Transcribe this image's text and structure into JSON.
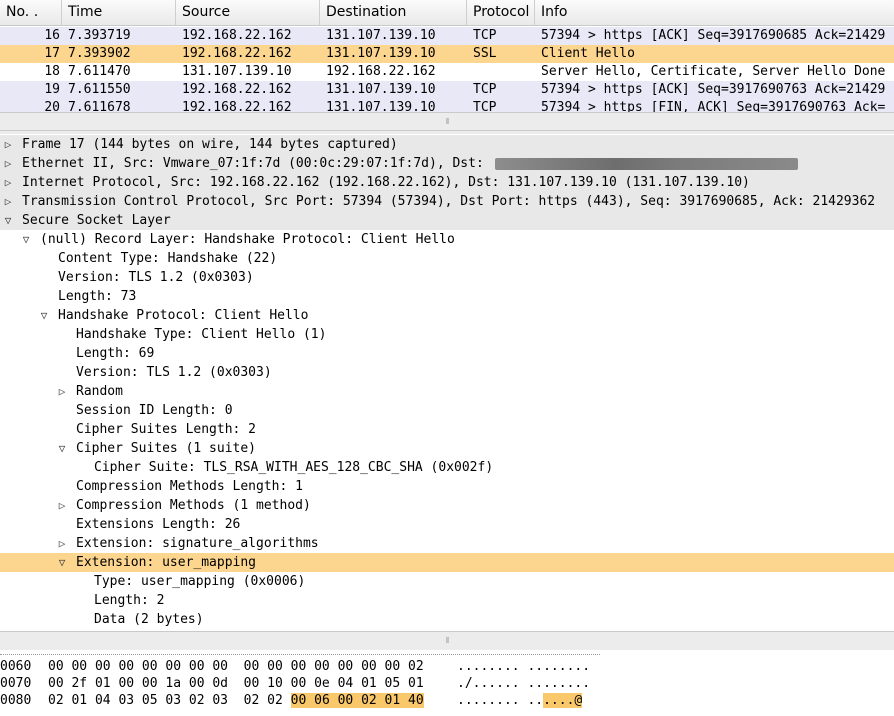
{
  "packet_list": {
    "columns": [
      "No. .",
      "Time",
      "Source",
      "Destination",
      "Protocol",
      "Info"
    ],
    "rows": [
      {
        "no": "16",
        "time": "7.393719",
        "source": "192.168.22.162",
        "destination": "131.107.139.10",
        "protocol": "TCP",
        "info": "57394 > https [ACK] Seq=3917690685 Ack=21429",
        "bg": "#e8e8f7"
      },
      {
        "no": "17",
        "time": "7.393902",
        "source": "192.168.22.162",
        "destination": "131.107.139.10",
        "protocol": "SSL",
        "info": "Client Hello",
        "bg": "#fcd58f"
      },
      {
        "no": "18",
        "time": "7.611470",
        "source": "131.107.139.10",
        "destination": "192.168.22.162",
        "protocol": "",
        "info": "Server Hello, Certificate, Server Hello Done",
        "bg": "#ffffff"
      },
      {
        "no": "19",
        "time": "7.611550",
        "source": "192.168.22.162",
        "destination": "131.107.139.10",
        "protocol": "TCP",
        "info": "57394 > https [ACK] Seq=3917690763 Ack=21429",
        "bg": "#e8e8f7"
      },
      {
        "no": "20",
        "time": "7.611678",
        "source": "192.168.22.162",
        "destination": "131.107.139.10",
        "protocol": "TCP",
        "info": "57394 > https [FIN, ACK] Seq=3917690763 Ack=",
        "bg": "#e8e8f7"
      }
    ]
  },
  "details": {
    "rows": [
      {
        "state": "collapsed",
        "text": "Frame 17 (144 bytes on wire, 144 bytes captured)",
        "level": 0,
        "bg": "#e8e8e8"
      },
      {
        "state": "collapsed",
        "text": "Ethernet II, Src: Vmware_07:1f:7d (00:0c:29:07:1f:7d), Dst:",
        "level": 0,
        "bg": "#e8e8e8",
        "redacted": true
      },
      {
        "state": "collapsed",
        "text": "Internet Protocol, Src: 192.168.22.162 (192.168.22.162), Dst: 131.107.139.10 (131.107.139.10)",
        "level": 0,
        "bg": "#e8e8e8"
      },
      {
        "state": "collapsed",
        "text": "Transmission Control Protocol, Src Port: 57394 (57394), Dst Port: https (443), Seq: 3917690685, Ack: 21429362",
        "level": 0,
        "bg": "#e8e8e8"
      },
      {
        "state": "expanded",
        "text": "Secure Socket Layer",
        "level": 0,
        "bg": "#e8e8e8"
      },
      {
        "state": "expanded",
        "text": "(null) Record Layer: Handshake Protocol: Client Hello",
        "level": 1,
        "bg": "#ffffff"
      },
      {
        "state": "leaf",
        "text": "Content Type: Handshake (22)",
        "level": 2,
        "bg": "#ffffff"
      },
      {
        "state": "leaf",
        "text": "Version: TLS 1.2 (0x0303)",
        "level": 2,
        "bg": "#ffffff"
      },
      {
        "state": "leaf",
        "text": "Length: 73",
        "level": 2,
        "bg": "#ffffff"
      },
      {
        "state": "expanded",
        "text": "Handshake Protocol: Client Hello",
        "level": 2,
        "bg": "#ffffff"
      },
      {
        "state": "leaf",
        "text": "Handshake Type: Client Hello (1)",
        "level": 3,
        "bg": "#ffffff"
      },
      {
        "state": "leaf",
        "text": "Length: 69",
        "level": 3,
        "bg": "#ffffff"
      },
      {
        "state": "leaf",
        "text": "Version: TLS 1.2 (0x0303)",
        "level": 3,
        "bg": "#ffffff"
      },
      {
        "state": "collapsed",
        "text": "Random",
        "level": 3,
        "bg": "#ffffff"
      },
      {
        "state": "leaf",
        "text": "Session ID Length: 0",
        "level": 3,
        "bg": "#ffffff"
      },
      {
        "state": "leaf",
        "text": "Cipher Suites Length: 2",
        "level": 3,
        "bg": "#ffffff"
      },
      {
        "state": "expanded",
        "text": "Cipher Suites (1 suite)",
        "level": 3,
        "bg": "#ffffff"
      },
      {
        "state": "leaf",
        "text": "Cipher Suite: TLS_RSA_WITH_AES_128_CBC_SHA (0x002f)",
        "level": 4,
        "bg": "#ffffff"
      },
      {
        "state": "leaf",
        "text": "Compression Methods Length: 1",
        "level": 3,
        "bg": "#ffffff"
      },
      {
        "state": "collapsed",
        "text": "Compression Methods (1 method)",
        "level": 3,
        "bg": "#ffffff"
      },
      {
        "state": "leaf",
        "text": "Extensions Length: 26",
        "level": 3,
        "bg": "#ffffff"
      },
      {
        "state": "collapsed",
        "text": "Extension: signature_algorithms",
        "level": 3,
        "bg": "#ffffff"
      },
      {
        "state": "expanded",
        "text": "Extension: user_mapping",
        "level": 3,
        "bg": "#fcd58f"
      },
      {
        "state": "leaf",
        "text": "Type: user_mapping (0x0006)",
        "level": 4,
        "bg": "#ffffff"
      },
      {
        "state": "leaf",
        "text": "Length: 2",
        "level": 4,
        "bg": "#ffffff"
      },
      {
        "state": "leaf",
        "text": "Data (2 bytes)",
        "level": 4,
        "bg": "#ffffff"
      }
    ]
  },
  "bytes": {
    "rows": [
      {
        "offset": "0060",
        "hex_normal": "00 00 00 00 00 00 00 00  00 00 00 00 00 00 00 02",
        "hex_hl": "",
        "ascii_normal": "........ ........",
        "ascii_hl": ""
      },
      {
        "offset": "0070",
        "hex_normal": "00 2f 01 00 00 1a 00 0d  00 10 00 0e 04 01 05 01",
        "hex_hl": "",
        "ascii_normal": "./...... ........",
        "ascii_hl": ""
      },
      {
        "offset": "0080",
        "hex_normal": "02 01 04 03 05 03 02 03  02 02 ",
        "hex_hl": "00 06 00 02 01 40",
        "ascii_normal": "........ ..",
        "ascii_hl": "....@"
      }
    ]
  },
  "colors": {
    "selected": "#fcd58f",
    "tcp_row": "#e8e8f7",
    "header_row": "#e8e8e8",
    "byte_highlight": "#f9c86a"
  }
}
